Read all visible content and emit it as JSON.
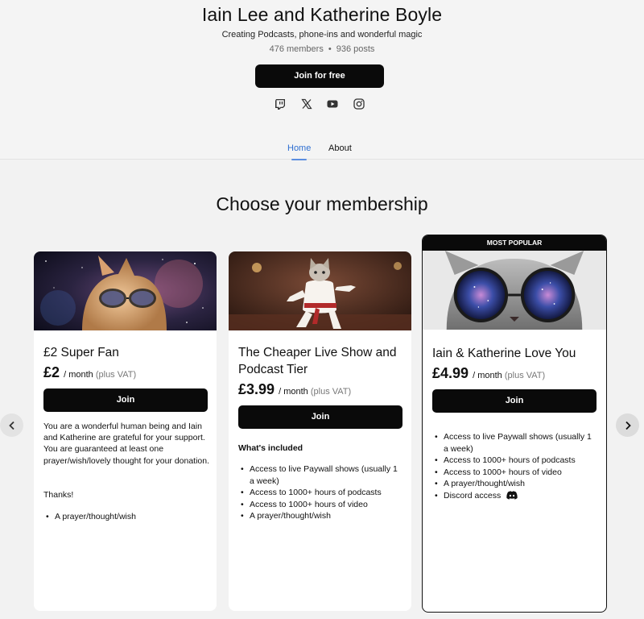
{
  "creator": {
    "name": "Iain Lee and Katherine Boyle",
    "tagline": "Creating Podcasts, phone-ins and wonderful magic",
    "members": "476 members",
    "separator": "•",
    "posts": "936 posts",
    "join_label": "Join for free",
    "socials": [
      "twitch-icon",
      "x-icon",
      "youtube-icon",
      "instagram-icon"
    ]
  },
  "tabs": [
    {
      "label": "Home",
      "active": true
    },
    {
      "label": "About",
      "active": false
    }
  ],
  "section_title": "Choose your membership",
  "tiers": [
    {
      "name": "£2 Super Fan",
      "price": "£2",
      "period": "/ month",
      "vat": "(plus VAT)",
      "join_label": "Join",
      "description": [
        "You are a wonderful human being and Iain and Katherine are grateful for your support. You are guaranteed at least one prayer/wish/lovely thought for your donation.",
        "Thanks!"
      ],
      "benefits": [
        "A prayer/thought/wish"
      ]
    },
    {
      "name": "The Cheaper Live Show and Podcast Tier",
      "price": "£3.99",
      "period": "/ month",
      "vat": "(plus VAT)",
      "join_label": "Join",
      "included_heading": "What's included",
      "benefits": [
        "Access to live Paywall shows (usually 1 a week)",
        "Access to 1000+ hours of podcasts",
        "Access to 1000+ hours of video",
        "A prayer/thought/wish"
      ]
    },
    {
      "badge": "MOST POPULAR",
      "name": "Iain & Katherine Love You",
      "price": "£4.99",
      "period": "/ month",
      "vat": "(plus VAT)",
      "join_label": "Join",
      "benefits": [
        "Access to live Paywall shows (usually 1 a week)",
        "Access to 1000+ hours of podcasts",
        "Access to 1000+ hours of video",
        "A prayer/thought/wish",
        "Discord access"
      ]
    }
  ],
  "colors": {
    "accent": "#2f6fd1",
    "button": "#0a0a0a",
    "background": "#f2f2f2"
  }
}
